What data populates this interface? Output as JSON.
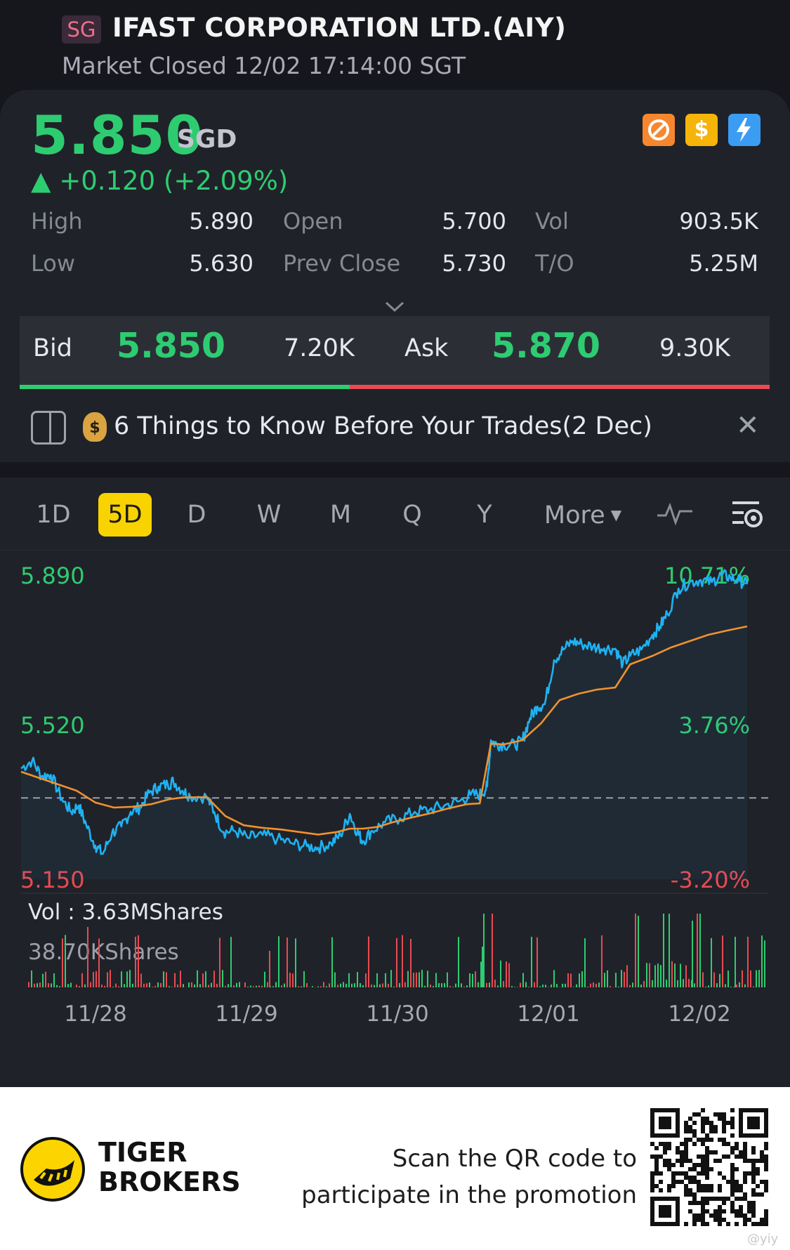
{
  "header": {
    "exchange_badge": "SG",
    "title": "IFAST CORPORATION LTD.(AIY)",
    "status": "Market Closed 12/02 17:14:00 SGT"
  },
  "quote": {
    "price": "5.850",
    "currency": "SGD",
    "change": "▲ +0.120 (+2.09%)",
    "stats": [
      {
        "label": "High",
        "value": "5.890"
      },
      {
        "label": "Open",
        "value": "5.700"
      },
      {
        "label": "Vol",
        "value": "903.5K"
      },
      {
        "label": "Low",
        "value": "5.630"
      },
      {
        "label": "Prev Close",
        "value": "5.730"
      },
      {
        "label": "T/O",
        "value": "5.25M"
      }
    ],
    "expand_icon": "chevron-down-icon",
    "bid_label": "Bid",
    "bid_price": "5.850",
    "bid_size": "7.20K",
    "ask_label": "Ask",
    "ask_price": "5.870",
    "ask_size": "9.30K",
    "bid_share": 0.44
  },
  "badges": [
    "no-short-icon",
    "dollar-icon",
    "flash-icon"
  ],
  "news": {
    "icon": "document-icon",
    "emoji_icon": "money-bag-icon",
    "text": "6 Things to Know Before Your Trades(2 Dec)",
    "close_icon": "close-icon"
  },
  "tabs": [
    "1D",
    "5D",
    "D",
    "W",
    "M",
    "Q",
    "Y",
    "More"
  ],
  "active_tab": "5D",
  "chart_data": {
    "type": "line",
    "series": [
      {
        "points": [
          [
            0.0,
            5.413
          ],
          [
            0.3,
            5.432
          ],
          [
            0.55,
            5.395
          ],
          [
            0.8,
            5.398
          ],
          [
            1.1,
            5.34
          ],
          [
            1.35,
            5.31
          ],
          [
            1.55,
            5.325
          ],
          [
            1.75,
            5.28
          ],
          [
            2.0,
            5.23
          ],
          [
            2.2,
            5.21
          ],
          [
            2.45,
            5.26
          ],
          [
            2.7,
            5.275
          ],
          [
            2.95,
            5.31
          ],
          [
            3.2,
            5.32
          ],
          [
            3.45,
            5.355
          ],
          [
            3.7,
            5.37
          ],
          [
            3.95,
            5.375
          ],
          [
            4.1,
            5.382
          ],
          [
            4.35,
            5.36
          ],
          [
            4.55,
            5.348
          ],
          [
            5.0,
            5.345
          ],
          [
            5.2,
            5.31
          ],
          [
            5.45,
            5.262
          ],
          [
            5.75,
            5.265
          ],
          [
            6.1,
            5.248
          ],
          [
            6.5,
            5.255
          ],
          [
            6.9,
            5.245
          ],
          [
            7.3,
            5.235
          ],
          [
            7.7,
            5.228
          ],
          [
            8.0,
            5.225
          ],
          [
            8.35,
            5.235
          ],
          [
            8.6,
            5.255
          ],
          [
            8.85,
            5.305
          ],
          [
            9.05,
            5.262
          ],
          [
            9.2,
            5.24
          ],
          [
            9.45,
            5.265
          ],
          [
            9.8,
            5.285
          ],
          [
            10.2,
            5.295
          ],
          [
            10.6,
            5.31
          ],
          [
            11.0,
            5.315
          ],
          [
            11.4,
            5.325
          ],
          [
            11.8,
            5.335
          ],
          [
            12.1,
            5.35
          ],
          [
            12.4,
            5.352
          ],
          [
            12.55,
            5.37
          ],
          [
            12.65,
            5.48
          ],
          [
            12.8,
            5.47
          ],
          [
            13.0,
            5.47
          ],
          [
            13.3,
            5.468
          ],
          [
            13.5,
            5.48
          ],
          [
            13.7,
            5.532
          ],
          [
            13.9,
            5.56
          ],
          [
            14.1,
            5.565
          ],
          [
            14.35,
            5.67
          ],
          [
            14.6,
            5.695
          ],
          [
            14.85,
            5.715
          ],
          [
            15.1,
            5.708
          ],
          [
            15.4,
            5.702
          ],
          [
            15.7,
            5.698
          ],
          [
            16.0,
            5.697
          ],
          [
            16.2,
            5.66
          ],
          [
            16.4,
            5.68
          ],
          [
            16.7,
            5.695
          ],
          [
            17.0,
            5.73
          ],
          [
            17.2,
            5.75
          ],
          [
            17.4,
            5.78
          ],
          [
            17.7,
            5.84
          ],
          [
            18.0,
            5.855
          ],
          [
            18.3,
            5.86
          ],
          [
            18.6,
            5.855
          ],
          [
            18.85,
            5.872
          ],
          [
            19.1,
            5.866
          ],
          [
            19.35,
            5.858
          ],
          [
            19.55,
            5.85
          ]
        ]
      },
      {
        "points": [
          [
            0.0,
            5.405
          ],
          [
            0.5,
            5.39
          ],
          [
            1.0,
            5.375
          ],
          [
            1.5,
            5.36
          ],
          [
            2.0,
            5.332
          ],
          [
            2.5,
            5.32
          ],
          [
            3.0,
            5.322
          ],
          [
            3.5,
            5.328
          ],
          [
            4.0,
            5.34
          ],
          [
            4.35,
            5.344
          ],
          [
            5.0,
            5.345
          ],
          [
            5.5,
            5.3
          ],
          [
            6.0,
            5.278
          ],
          [
            6.5,
            5.272
          ],
          [
            7.0,
            5.268
          ],
          [
            7.5,
            5.262
          ],
          [
            8.0,
            5.256
          ],
          [
            8.5,
            5.262
          ],
          [
            8.85,
            5.27
          ],
          [
            9.2,
            5.27
          ],
          [
            9.6,
            5.274
          ],
          [
            10.0,
            5.285
          ],
          [
            10.5,
            5.296
          ],
          [
            11.0,
            5.306
          ],
          [
            11.5,
            5.318
          ],
          [
            12.0,
            5.328
          ],
          [
            12.35,
            5.33
          ],
          [
            12.65,
            5.472
          ],
          [
            13.0,
            5.47
          ],
          [
            13.5,
            5.48
          ],
          [
            14.0,
            5.52
          ],
          [
            14.5,
            5.575
          ],
          [
            15.0,
            5.59
          ],
          [
            15.5,
            5.6
          ],
          [
            16.0,
            5.605
          ],
          [
            16.4,
            5.66
          ],
          [
            17.0,
            5.68
          ],
          [
            17.5,
            5.7
          ],
          [
            18.0,
            5.715
          ],
          [
            18.5,
            5.73
          ],
          [
            19.0,
            5.74
          ],
          [
            19.55,
            5.75
          ]
        ]
      }
    ],
    "prev_close": 5.343,
    "y_range": [
      5.15,
      5.89
    ],
    "y_ticks_left": [
      "5.890",
      "5.520",
      "5.150"
    ],
    "y_ticks_right": [
      "10.71%",
      "3.76%",
      "-3.20%"
    ],
    "x_ticks": [
      "11/28",
      "11/29",
      "11/30",
      "12/01",
      "12/02"
    ],
    "volume_label": "Vol :  3.63MShares",
    "volume_max_label": "38.70KShares",
    "volume_max": 38.7,
    "colors": {
      "price": "#1fb2f2",
      "avg": "#f0922f",
      "up": "#2ecc71",
      "down": "#e84b52"
    }
  },
  "footer": {
    "brand_line1": "TIGER",
    "brand_line2": "BROKERS",
    "promo_line1": "Scan the QR code to",
    "promo_line2": "participate in the promotion",
    "watermark": "@yiy"
  }
}
